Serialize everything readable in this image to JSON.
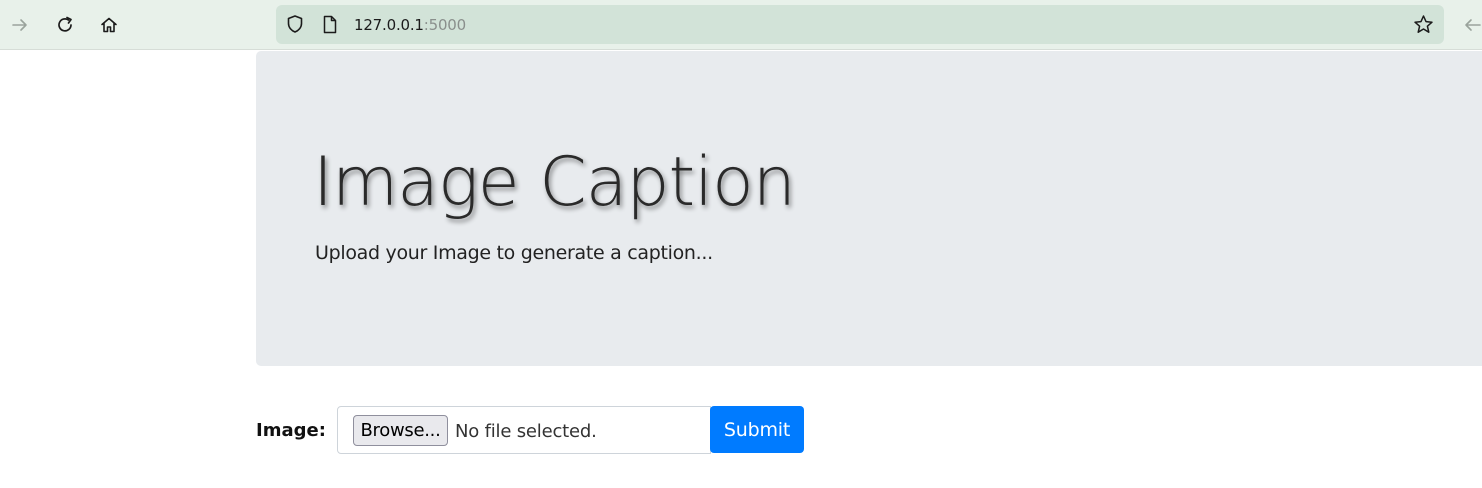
{
  "browser": {
    "url_host": "127.0.0.1",
    "url_port": ":5000",
    "icons": [
      "forward-arrow-icon",
      "reload-icon",
      "home-icon",
      "shield-icon",
      "page-icon",
      "bookmark-star-icon",
      "back-arrow-icon"
    ]
  },
  "hero": {
    "title": "Image Caption",
    "subtitle": "Upload your Image to generate a caption..."
  },
  "form": {
    "label": "Image:",
    "browse_label": "Browse...",
    "file_status": "No file selected.",
    "submit_label": "Submit"
  },
  "colors": {
    "toolbar_bg": "#e8f1ea",
    "urlbar_bg": "#d2e3d8",
    "hero_bg": "#e8ebee",
    "submit_bg": "#007bff"
  }
}
